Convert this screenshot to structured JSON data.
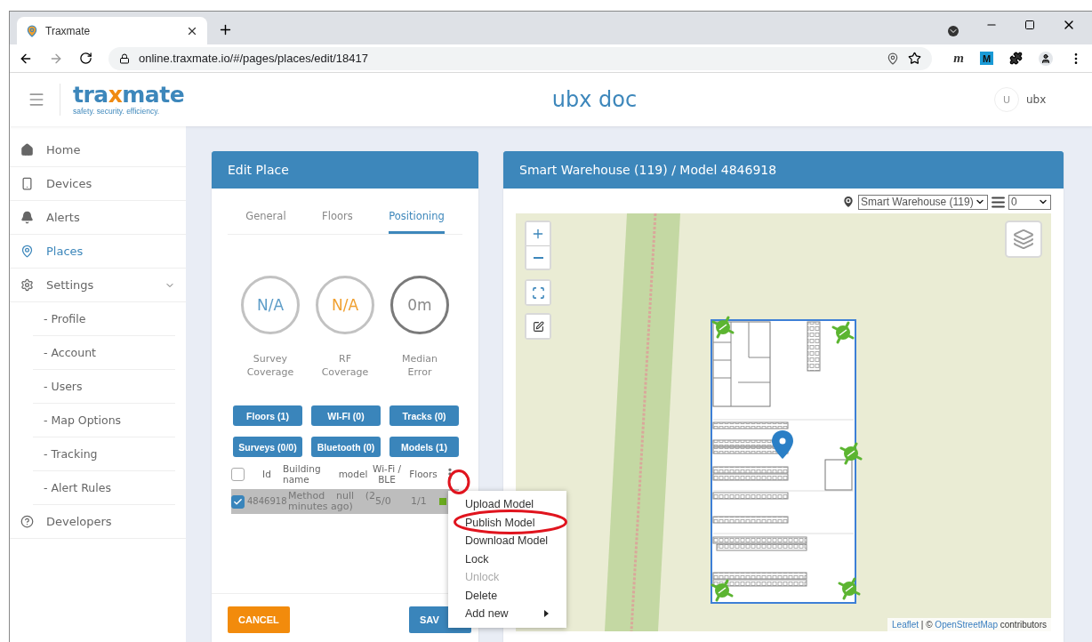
{
  "browser": {
    "tab": {
      "title": "Traxmate",
      "selected": true
    },
    "url": "online.traxmate.io/#/pages/places/edit/18417",
    "extension_labels": [
      "m",
      "M"
    ]
  },
  "header": {
    "logo": {
      "lead": "tra",
      "mark": "x",
      "tail": "mate",
      "tagline": "safety. security. efficiency."
    },
    "title": "ubx doc",
    "user": {
      "initial": "U",
      "name": "ubx"
    }
  },
  "sidebar": {
    "items": [
      {
        "label": "Home",
        "kind": "home",
        "selected": false
      },
      {
        "label": "Devices",
        "kind": "device",
        "selected": false
      },
      {
        "label": "Alerts",
        "kind": "bell",
        "selected": false
      },
      {
        "label": "Places",
        "kind": "pin",
        "selected": true
      },
      {
        "label": "Settings",
        "kind": "gear",
        "selected": false,
        "expanded": true,
        "children": [
          {
            "label": "- Profile",
            "selected": false
          },
          {
            "label": "- Account",
            "selected": false
          },
          {
            "label": "- Users",
            "selected": false
          },
          {
            "label": "- Map Options",
            "selected": false
          },
          {
            "label": "- Tracking",
            "selected": false
          },
          {
            "label": "- Alert Rules",
            "selected": false
          }
        ]
      },
      {
        "label": "Developers",
        "kind": "help",
        "selected": false
      }
    ]
  },
  "edit_place": {
    "title": "Edit Place",
    "tabs": [
      {
        "label": "General",
        "selected": false
      },
      {
        "label": "Floors",
        "selected": false
      },
      {
        "label": "Positioning",
        "selected": true
      }
    ],
    "gauges": [
      {
        "value": "N/A",
        "label": "Survey Coverage",
        "color": "#5e9dc8",
        "kind": "pending"
      },
      {
        "value": "N/A",
        "label": "RF Coverage",
        "color": "#f0a030",
        "kind": "pending"
      },
      {
        "value": "0m",
        "label": "Median Error",
        "color": "#8a8a8a",
        "kind": "measured"
      }
    ],
    "buttons": [
      "Floors (1)",
      "WI-FI (0)",
      "Tracks (0)",
      "Surveys (0/0)",
      "Bluetooth (0)",
      "Models (1)"
    ],
    "table": {
      "header_checked": false,
      "columns": [
        "Id",
        "Building name",
        "model",
        "Wi-Fi / BLE",
        "Floors"
      ],
      "rows": [
        {
          "checked": true,
          "selected": true,
          "id": "4846918",
          "name": "Method null (2 minutes ago)",
          "wifi_ble": "5/0",
          "floors": "1/1",
          "active": true
        }
      ]
    },
    "actions": [
      {
        "label": "CANCEL",
        "kind": "cancel"
      },
      {
        "label": "SAV",
        "kind": "save"
      }
    ]
  },
  "menu": {
    "items": [
      {
        "label": "Upload Model",
        "disabled": false,
        "submenu": false
      },
      {
        "label": "Publish Model",
        "disabled": false,
        "submenu": false
      },
      {
        "label": "Download Model",
        "disabled": false,
        "submenu": false
      },
      {
        "label": "Lock",
        "disabled": false,
        "submenu": false
      },
      {
        "label": "Unlock",
        "disabled": true,
        "submenu": false
      },
      {
        "label": "Delete",
        "disabled": false,
        "submenu": false
      },
      {
        "label": "Add new",
        "disabled": false,
        "submenu": true
      }
    ]
  },
  "map_panel": {
    "title": "Smart Warehouse (119) / Model 4846918",
    "place_select": "Smart Warehouse (119)",
    "floor_select": "0",
    "attribution": {
      "leaflet": "Leaflet",
      "separator": "| ©",
      "osm": "OpenStreetMap",
      "suffix": "contributors"
    }
  }
}
